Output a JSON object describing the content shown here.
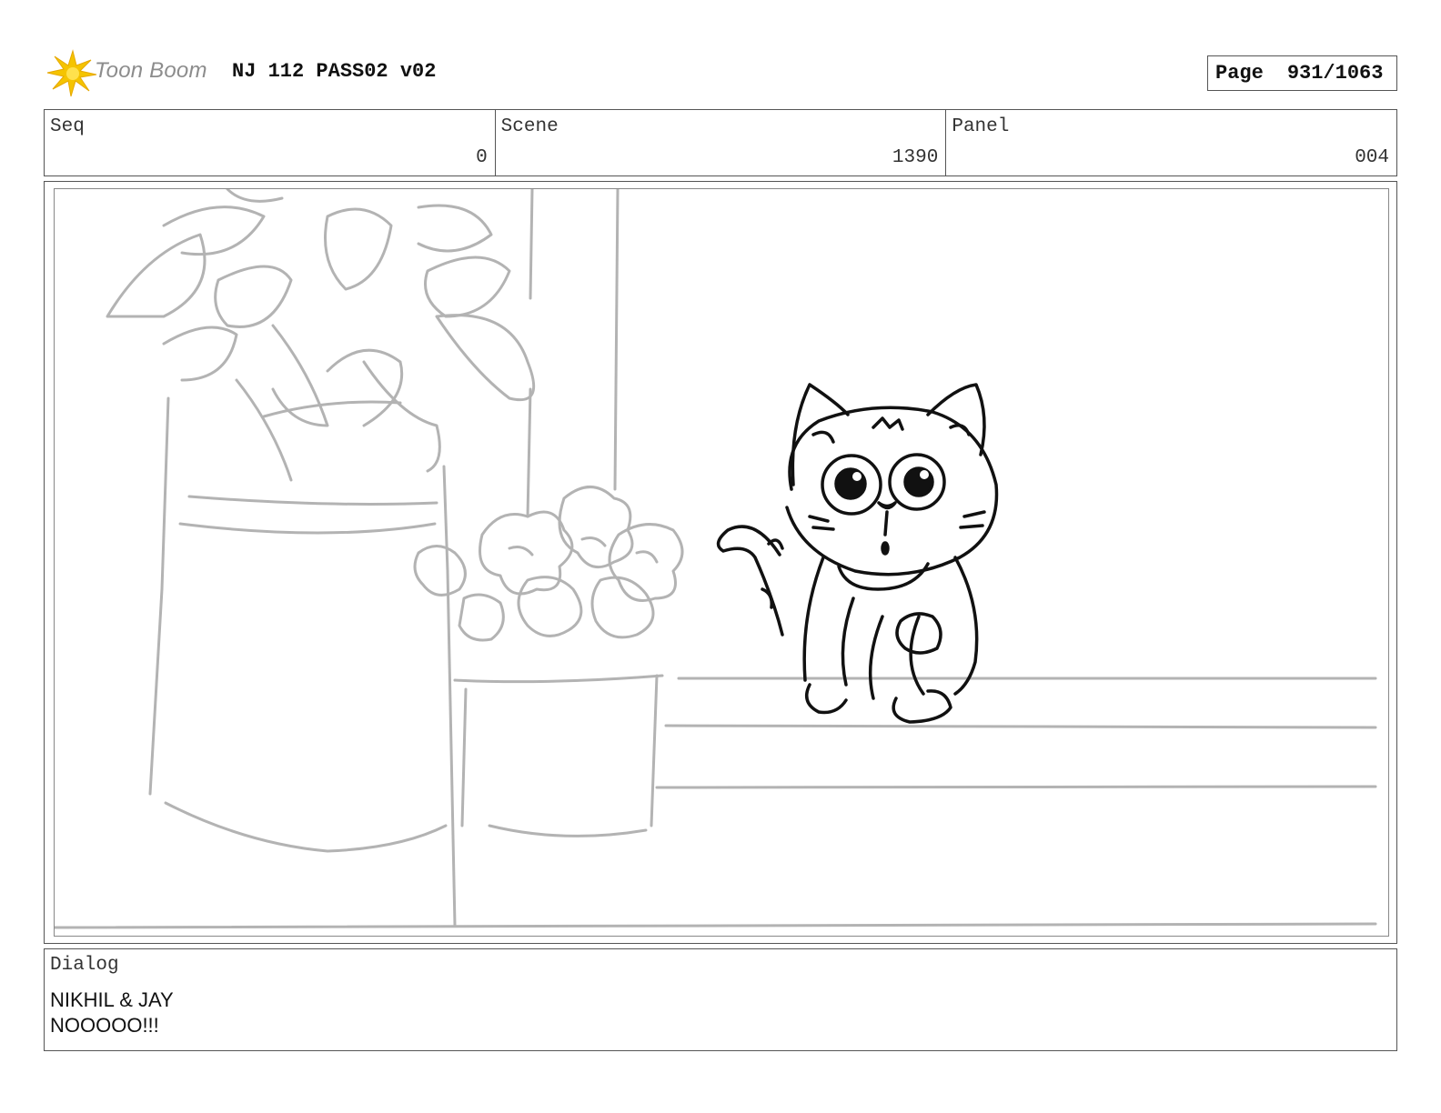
{
  "header": {
    "logo_text": "Toon Boom",
    "title": "NJ 112 PASS02 v02",
    "page_label": "Page",
    "page_value": "931/1063"
  },
  "info": {
    "seq_label": "Seq",
    "seq_value": "0",
    "scene_label": "Scene",
    "scene_value": "1390",
    "panel_label": "Panel",
    "panel_value": "004"
  },
  "dialog": {
    "label": "Dialog",
    "lines": [
      "NIKHIL & JAY",
      "NOOOOO!!!"
    ]
  },
  "colors": {
    "logo_accent": "#f5c400",
    "sketch_line": "#b3b3b3",
    "ink_line": "#111111"
  }
}
